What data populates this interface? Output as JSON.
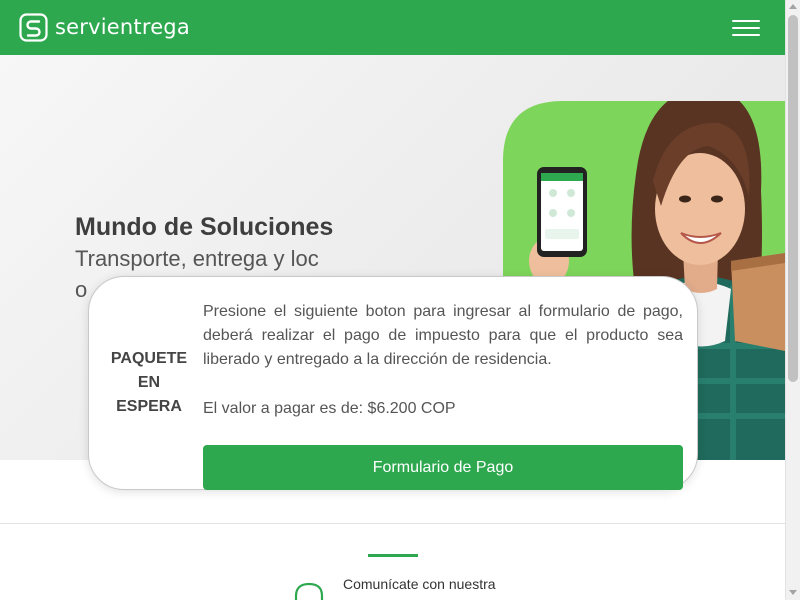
{
  "header": {
    "brand": "servientrega",
    "menu_icon": "hamburger-menu-icon",
    "color": "#2ea84f"
  },
  "hero": {
    "title": "Mundo de Soluciones",
    "subtitle": "Transporte, entrega y loc",
    "subtitle_line3": "o",
    "image": "woman-holding-phone-and-package-photo"
  },
  "modal": {
    "status_label": "PAQUETE EN ESPERA",
    "message": "Presione el siguiente boton para ingresar al formulario de pago, deberá realizar el pago de impuesto para que el producto sea liberado y entregado a la dirección de residencia.",
    "amount_text": "El valor a pagar es de: $6.200 COP",
    "button_label": "Formulario de Pago"
  },
  "contact": {
    "text": "Comunícate con nuestra",
    "icon": "headset-icon"
  },
  "colors": {
    "brand_green": "#2ea84f",
    "light_green": "#7ed55b"
  }
}
